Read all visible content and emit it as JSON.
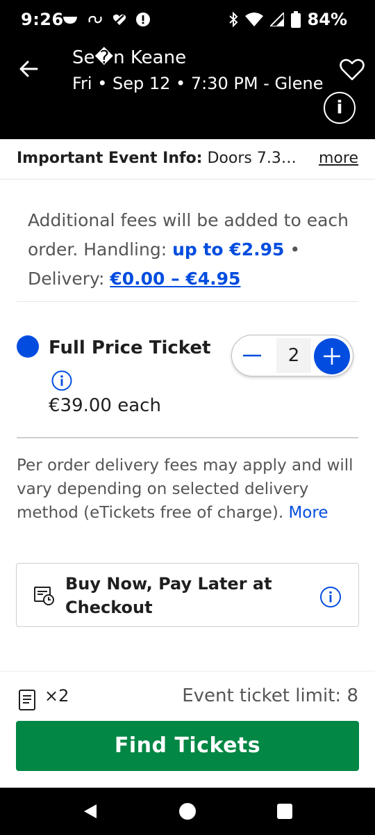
{
  "status_bar": {
    "time": "9:26",
    "battery": "84%",
    "icons": [
      "bowl-icon",
      "link-icon",
      "heart-slash-icon",
      "alert-icon",
      "bluetooth-icon",
      "wifi-icon",
      "signal-icon",
      "battery-icon"
    ]
  },
  "header": {
    "title": "Se�n Keane",
    "subtitle": "Fri • Sep 12 • 7:30 PM - Glene",
    "info_label": "i"
  },
  "event_info": {
    "label": "Important Event Info:",
    "text": " Doors 7.3…",
    "more": "more"
  },
  "fees": {
    "line_prefix": "Additional fees will be added to each order. Handling: ",
    "handling": "up to €2.95",
    "separator": " • Delivery: ",
    "delivery": "€0.00 – €4.95"
  },
  "ticket": {
    "name": "Full Price Ticket",
    "price": "€39.00 each",
    "quantity": "2"
  },
  "delivery_note": {
    "text": "Per order delivery fees may apply and will vary depending on selected delivery method (eTickets free of charge). ",
    "more": "More"
  },
  "bnpl": {
    "text": "Buy Now, Pay Later at Checkout"
  },
  "footer": {
    "count": "×2",
    "limit": "Event ticket limit: 8",
    "button": "Find Tickets"
  },
  "colors": {
    "primary_blue": "#024ddf",
    "button_green": "#028744",
    "header_bg": "#000000"
  }
}
